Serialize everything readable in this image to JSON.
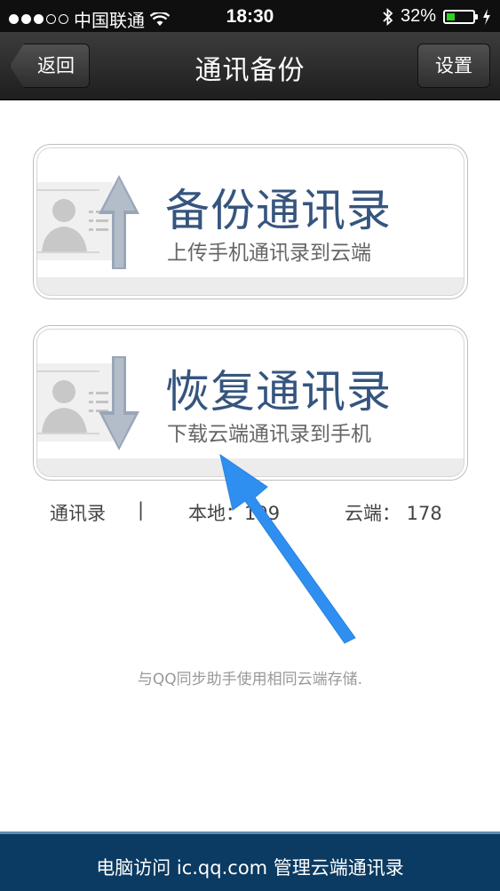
{
  "status_bar": {
    "carrier": "中国联通",
    "time": "18:30",
    "battery": "32%",
    "battery_level": 0.32
  },
  "nav": {
    "back_label": "返回",
    "title": "通讯备份",
    "settings_label": "设置"
  },
  "backup_card": {
    "title": "备份通讯录",
    "subtitle": "上传手机通讯录到云端",
    "icon": "contact-upload-icon"
  },
  "restore_card": {
    "title": "恢复通讯录",
    "subtitle": "下载云端通讯录到手机",
    "icon": "contact-download-icon"
  },
  "stats": {
    "label": "通讯录",
    "separator": "|",
    "local": "本地：199",
    "cloud": "云端： 178"
  },
  "note": "与QQ同步助手使用相同云端存储.",
  "footer": {
    "text": "电脑访问 ic.qq.com 管理云端通讯录"
  },
  "colors": {
    "nav_bg": "#2a2a2a",
    "card_title": "#35557e",
    "footer_bg": "#0b3a62",
    "annotation_arrow": "#2f8ff0"
  }
}
